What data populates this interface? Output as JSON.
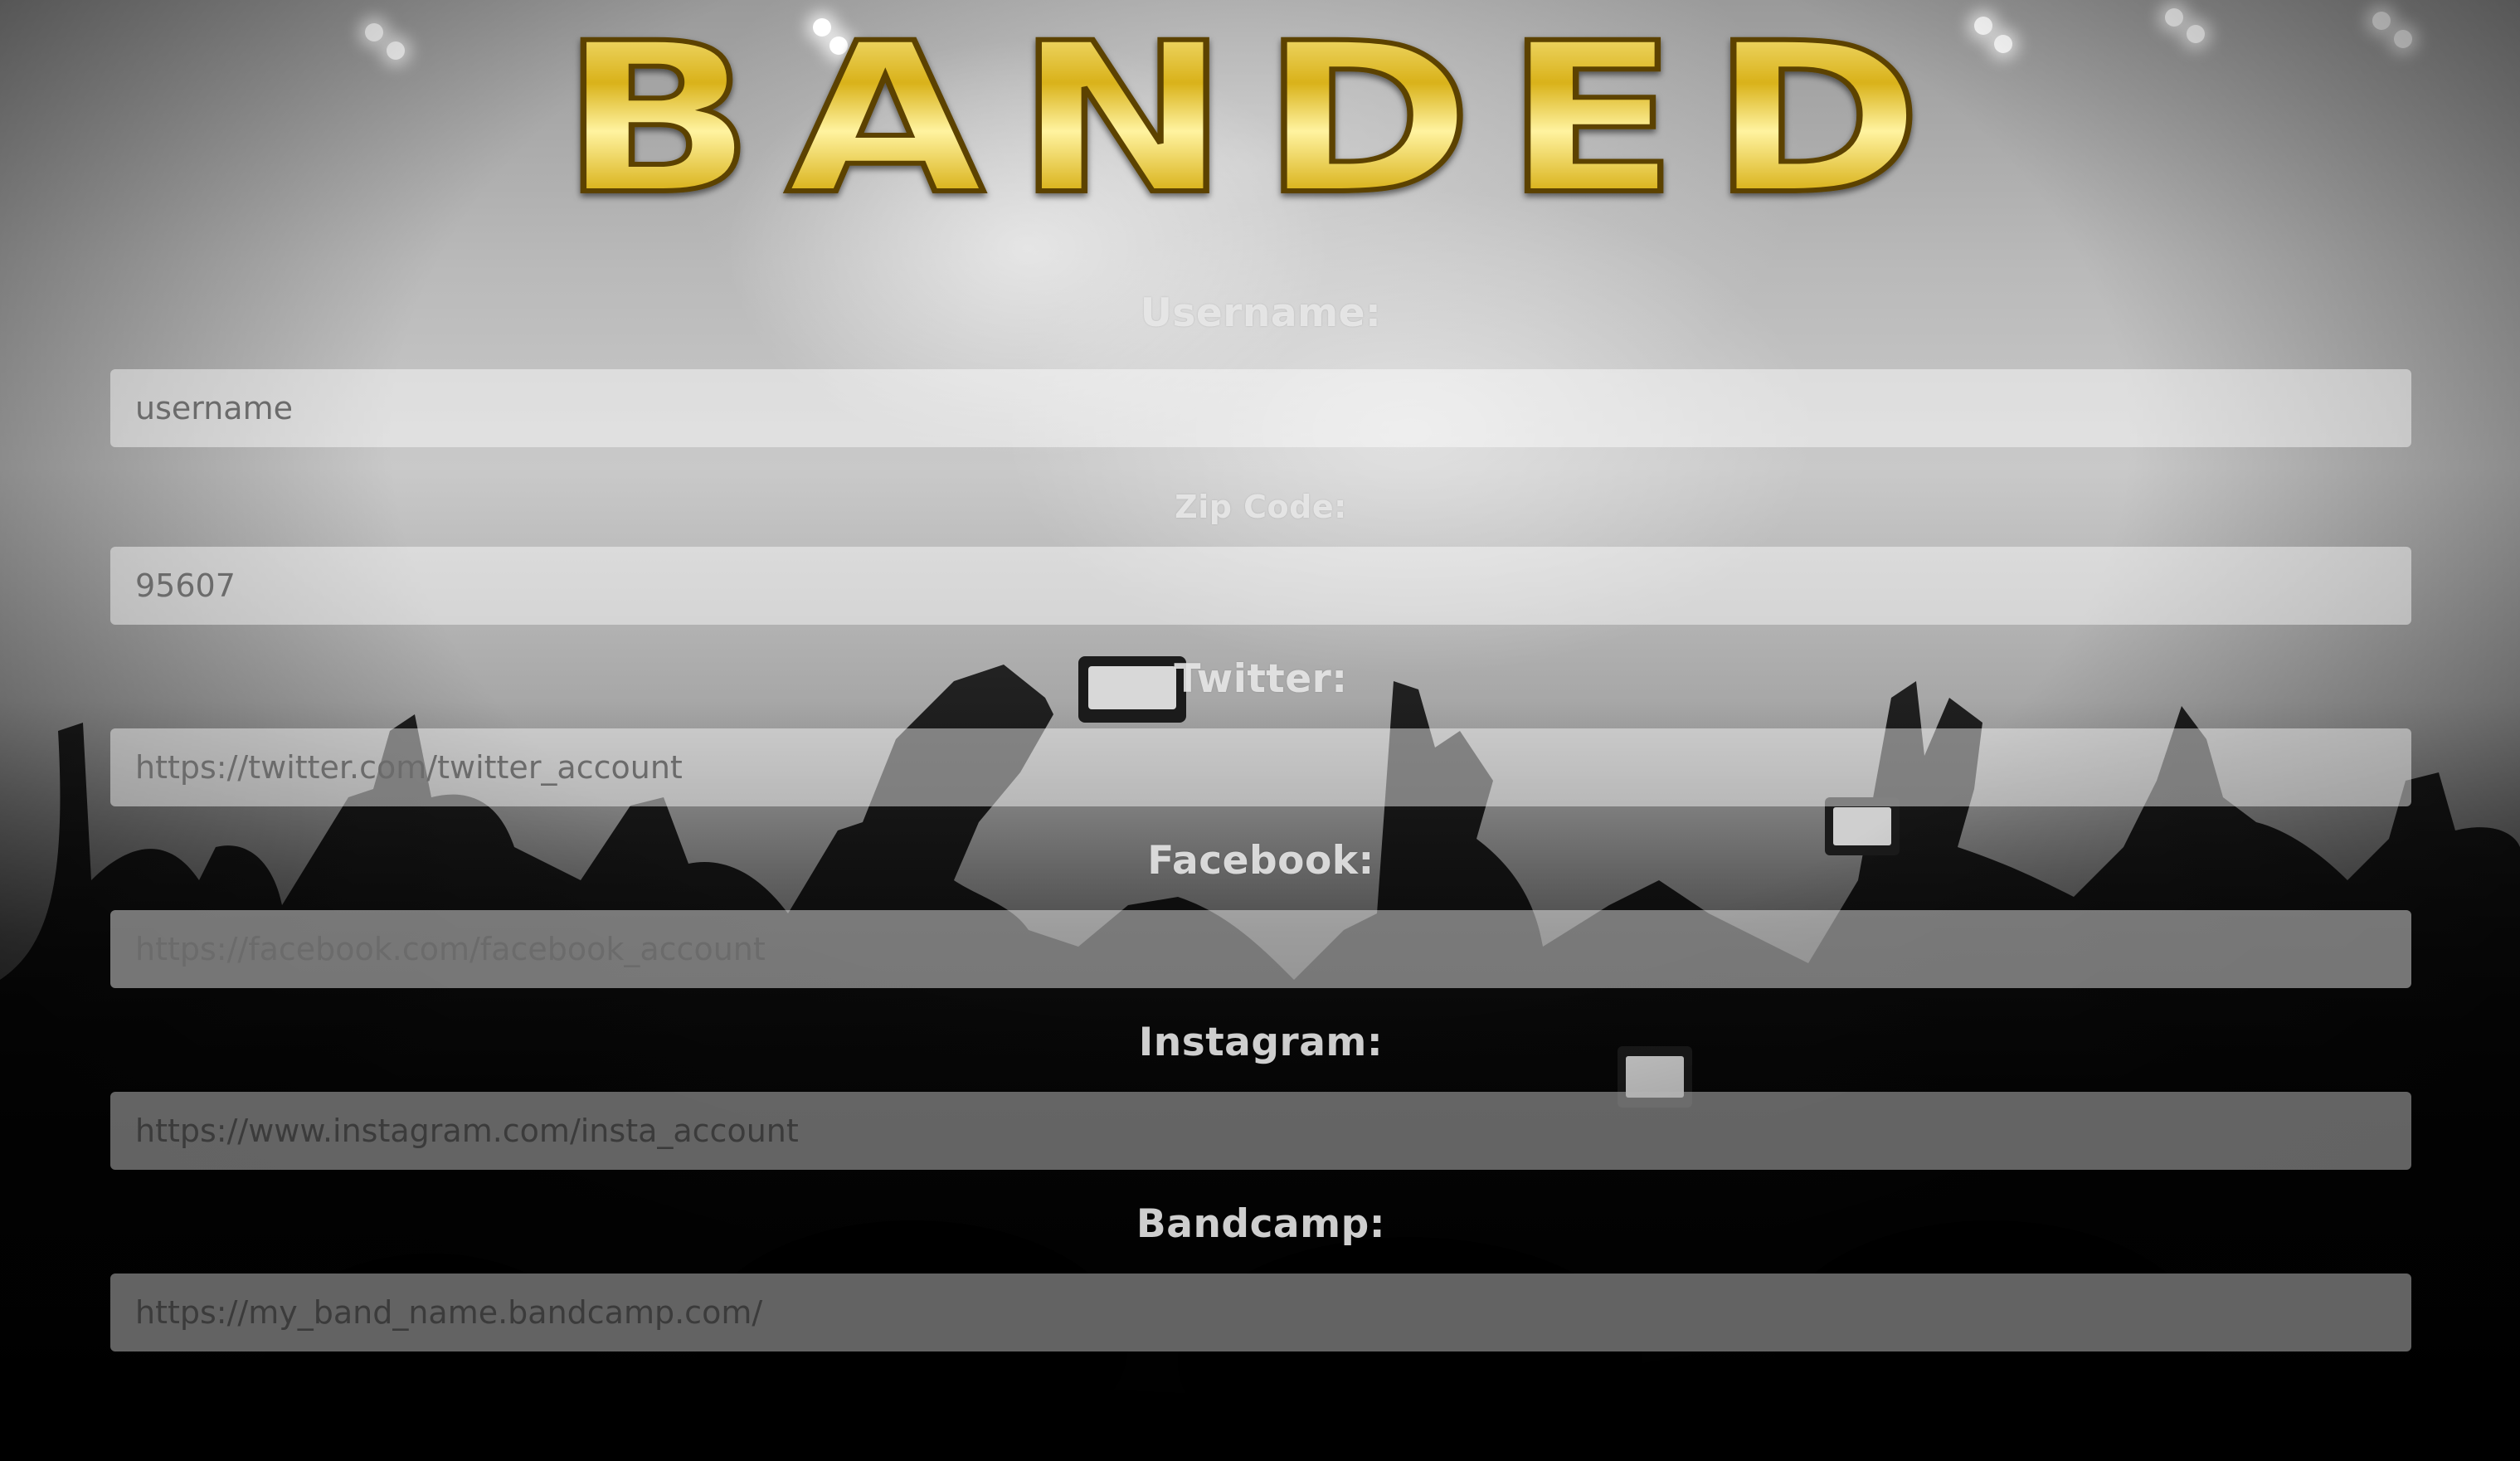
{
  "logo": {
    "text": "BANDED",
    "gold_light": "#fff3a0",
    "gold_mid": "#d9b21a",
    "gold_dark": "#7a5a00"
  },
  "form": {
    "username": {
      "label": "Username:",
      "placeholder": "username",
      "value": ""
    },
    "zip": {
      "label": "Zip Code:",
      "placeholder": "95607",
      "value": ""
    },
    "twitter": {
      "label": "Twitter:",
      "placeholder": "https://twitter.com/twitter_account",
      "value": ""
    },
    "facebook": {
      "label": "Facebook:",
      "placeholder": "https://facebook.com/facebook_account",
      "value": ""
    },
    "instagram": {
      "label": "Instagram:",
      "placeholder": "https://www.instagram.com/insta_account",
      "value": ""
    },
    "bandcamp": {
      "label": "Bandcamp:",
      "placeholder": "https://my_band_name.bandcamp.com/",
      "value": ""
    }
  },
  "colors": {
    "label_text": "#ebebeb",
    "input_light_bg": "#ffffff",
    "input_dark_bg": "#b4b4b4",
    "input_text": "#5e5e5e"
  }
}
